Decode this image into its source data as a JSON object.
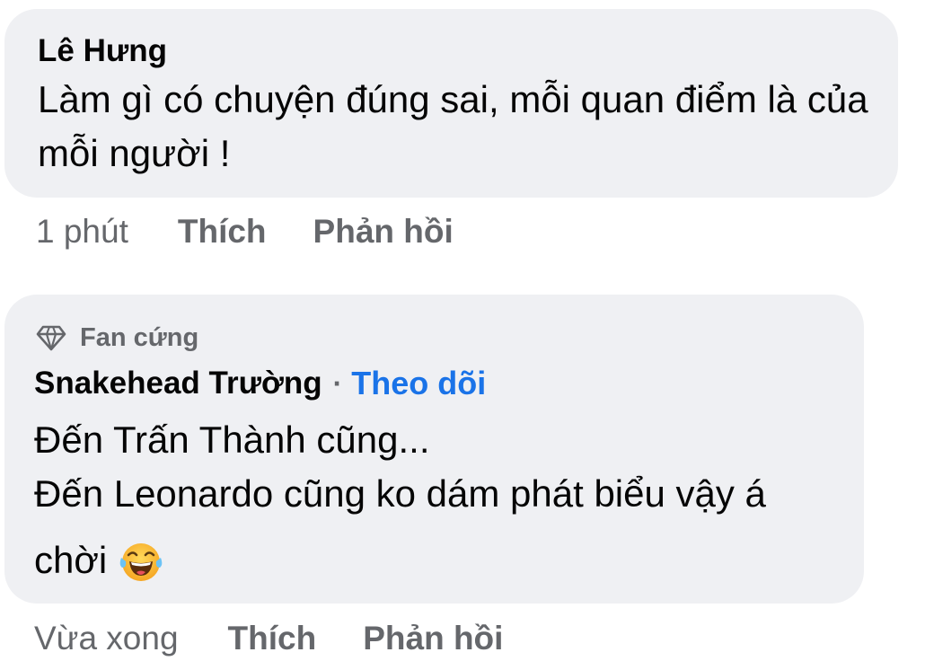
{
  "comments": [
    {
      "author": "Lê Hưng",
      "text": "Làm gì có chuyện đúng sai, mỗi quan điểm là của mỗi người !",
      "time": "1 phút",
      "like_label": "Thích",
      "reply_label": "Phản hồi"
    },
    {
      "badge_label": "Fan cứng",
      "badge_icon": "diamond-icon",
      "author": "Snakehead Trường",
      "separator": "·",
      "follow_label": "Theo dõi",
      "text_lines": [
        "Đến Trấn Thành cũng...",
        "Đến Leonardo cũng ko dám phát biểu vậy á",
        "chời"
      ],
      "emoji": "face-with-tears-of-joy-emoji",
      "time": "Vừa xong",
      "like_label": "Thích",
      "reply_label": "Phản hồi"
    }
  ],
  "colors": {
    "bubble_bg": "#eff0f3",
    "text": "#050505",
    "muted": "#65676b",
    "link": "#1a73e8"
  }
}
